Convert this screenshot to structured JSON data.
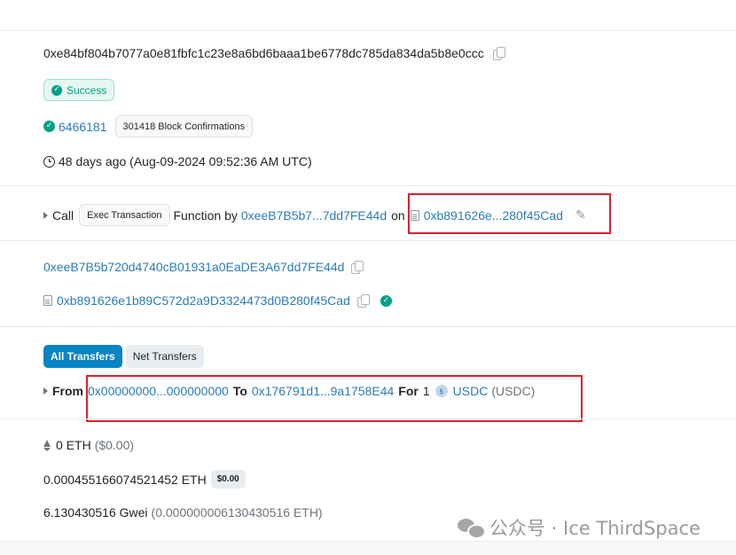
{
  "tx_hash": "0xe84bf804b7077a0e81fbfc1c23e8a6bd6baaa1be6778dc785da834da5b8e0ccc",
  "status": "Success",
  "block": {
    "number": "6466181",
    "confirmations": "301418 Block Confirmations"
  },
  "timestamp": "48 days ago (Aug-09-2024 09:52:36 AM UTC)",
  "action": {
    "call_label": "Call",
    "method": "Exec Transaction",
    "function_by": "Function by",
    "from_short": "0xeeB7B5b7...7dd7FE44d",
    "on_label": "on",
    "to_short": "0xb891626e...280f45Cad"
  },
  "from_address": "0xeeB7B5b720d4740cB01931a0EaDE3A67dd7FE44d",
  "to_address": "0xb891626e1b89C572d2a9D3324473d0B280f45Cad",
  "transfers": {
    "tabs": [
      "All Transfers",
      "Net Transfers"
    ],
    "from_label": "From",
    "from": "0x00000000...000000000",
    "to_label": "To",
    "to": "0x176791d1...9a1758E44",
    "for_label": "For",
    "amount": "1",
    "token": "USDC",
    "token_symbol": "(USDC)"
  },
  "value": {
    "amount": "0 ETH",
    "usd": "($0.00)"
  },
  "fee": {
    "amount": "0.000455166074521452 ETH",
    "usd": "$0.00"
  },
  "gas_price": {
    "gwei": "6.130430516 Gwei",
    "eth": "(0.000000006130430516 ETH)"
  },
  "watermark": "公众号 · Ice ThirdSpace",
  "colors": {
    "link": "#2b7bb9",
    "success": "#00a186",
    "highlight": "#e0202a",
    "tab_active": "#0784c3"
  }
}
